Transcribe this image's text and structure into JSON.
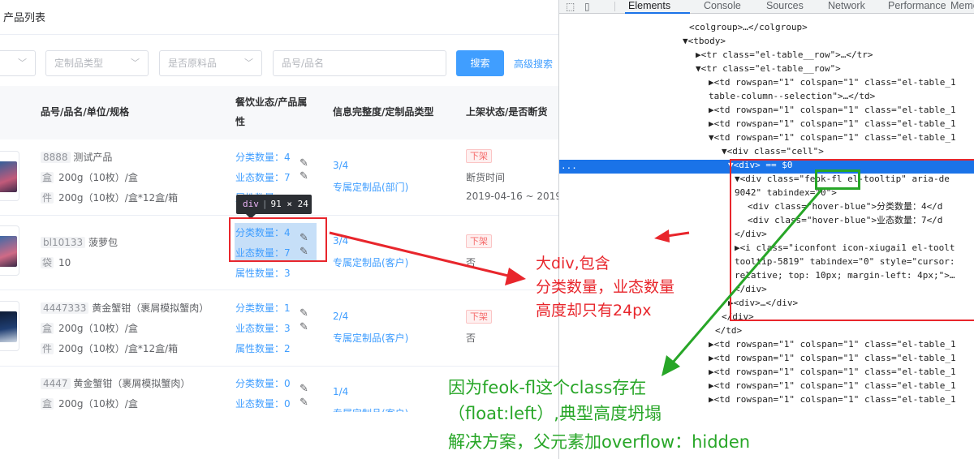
{
  "app": {
    "title": "产品列表",
    "filters": {
      "select1": "",
      "select2": "定制品类型",
      "select3": "是否原料品",
      "search_placeholder": "品号/品名",
      "search_button": "搜索",
      "advanced": "高级搜索"
    },
    "table": {
      "headers": [
        "品号/品名/单位/规格",
        "餐饮业态/产品属",
        "性",
        "信息完整度/定制品类型",
        "上架状态/是否断货"
      ],
      "rows": [
        {
          "code": "8888",
          "name": "测试产品",
          "units": [
            {
              "unit": "盒",
              "spec": "200g（10枚）/盒"
            },
            {
              "unit": "件",
              "spec": "200g（10枚）/盒*12盒/箱"
            }
          ],
          "cat_count": "分类数量：4",
          "biz_count": "业态数量：7",
          "attr_count": "属性数量",
          "completeness": "3/4",
          "custom_type": "专属定制品(部门)",
          "status": "下架",
          "stock_label": "断货时间",
          "stock_value": "2019-04-16 ~ 2019"
        },
        {
          "code": "bl10133",
          "name": "菠萝包",
          "units": [
            {
              "unit": "袋",
              "spec": "10"
            }
          ],
          "cat_count": "分类数量：4",
          "biz_count": "业态数量：7",
          "attr_count": "属性数量：3",
          "completeness": "3/4",
          "custom_type": "专属定制品(客户)",
          "status": "下架",
          "stock_label": "否",
          "stock_value": ""
        },
        {
          "code": "4447333",
          "name": "黄金蟹钳（裹屑模拟蟹肉）",
          "units": [
            {
              "unit": "盒",
              "spec": "200g（10枚）/盒"
            },
            {
              "unit": "件",
              "spec": "200g（10枚）/盒*12盒/箱"
            }
          ],
          "cat_count": "分类数量：1",
          "biz_count": "业态数量：3",
          "attr_count": "属性数量：2",
          "completeness": "2/4",
          "custom_type": "专属定制品(客户)",
          "status": "下架",
          "stock_label": "否",
          "stock_value": ""
        },
        {
          "code": "4447",
          "name": "黄金蟹钳（裹屑模拟蟹肉）",
          "units": [
            {
              "unit": "盒",
              "spec": "200g（10枚）/盒"
            }
          ],
          "cat_count": "分类数量：0",
          "biz_count": "业态数量：0",
          "attr_count": "",
          "completeness": "1/4",
          "custom_type": "专属定制品(客户)",
          "status": "",
          "stock_label": "",
          "stock_value": ""
        }
      ]
    },
    "inspect_tooltip": {
      "tag": "div",
      "size": "91 × 24"
    }
  },
  "devtools": {
    "tabs": [
      "Elements",
      "Console",
      "Sources",
      "Network",
      "Performance",
      "Memo"
    ],
    "active_tab": "Elements",
    "lines": [
      "<colgroup>…</colgroup>",
      "▼<tbody>",
      "▶<tr class=\"el-table__row\">…</tr>",
      "▼<tr class=\"el-table__row\">",
      "▶<td rowspan=\"1\" colspan=\"1\" class=\"el-table_1",
      "table-column--selection\">…</td>",
      "▶<td rowspan=\"1\" colspan=\"1\" class=\"el-table_1",
      "▶<td rowspan=\"1\" colspan=\"1\" class=\"el-table_1",
      "▼<td rowspan=\"1\" colspan=\"1\" class=\"el-table_1",
      "▼<div class=\"cell\">",
      "▼<div> == $0",
      "▼<div class=\"feok-fl el-tooltip\" aria-de",
      "9042\" tabindex=\"0\">",
      "<div class=\"hover-blue\">分类数量：4</d",
      "<div class=\"hover-blue\">业态数量：7</d",
      "</div>",
      "▶<i class=\"iconfont icon-xiugai1 el-toolt",
      "tooltip-5819\" tabindex=\"0\" style=\"cursor:",
      "relative; top: 10px; margin-left: 4px;\">…",
      "</div>",
      "▶<div>…</div>",
      "</div>",
      "</td>",
      "▶<td rowspan=\"1\" colspan=\"1\" class=\"el-table_1",
      "▶<td rowspan=\"1\" colspan=\"1\" class=\"el-table_1",
      "▶<td rowspan=\"1\" colspan=\"1\" class=\"el-table_1",
      "▶<td rowspan=\"1\" colspan=\"1\" class=\"el-table_1",
      "▶<td rowspan=\"1\" colspan=\"1\" class=\"el-table_1"
    ]
  },
  "annotations": {
    "red": [
      "大div,包含",
      "分类数量，业态数量",
      "高度却只有24px"
    ],
    "green": [
      "因为feok-fl这个class存在",
      "（float:left）,典型高度坍塌",
      "解决方案，父元素加overflow：hidden"
    ]
  },
  "colors": {
    "accent": "#409eff",
    "annotation_red": "#e8262c",
    "annotation_green": "#27a627",
    "selection": "#1a73e8"
  }
}
